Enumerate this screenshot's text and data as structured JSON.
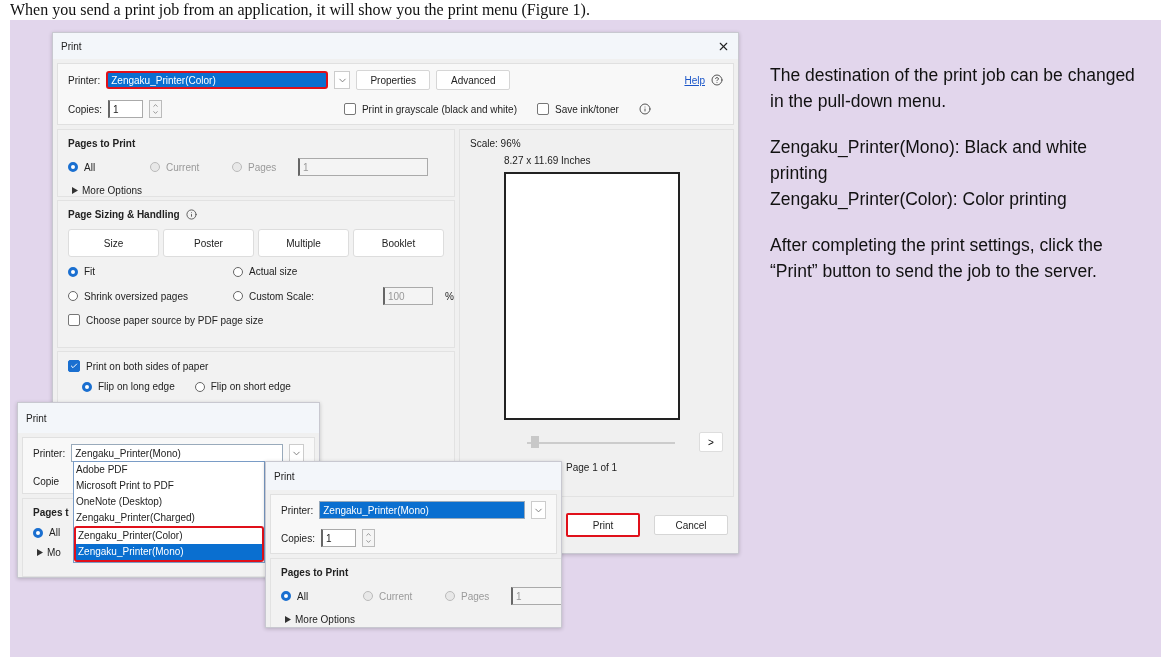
{
  "caption": "When you send a print job from an application, it will show you the print menu (Figure 1).",
  "main_dialog": {
    "title": "Print",
    "printer": {
      "label": "Printer:",
      "value": "Zengaku_Printer(Color)",
      "highlighted": true
    },
    "buttons": [
      "Properties",
      "Advanced"
    ],
    "help_link": "Help",
    "copies": {
      "label": "Copies:",
      "value": "1"
    },
    "options": [
      {
        "label": "Print in grayscale (black and white)",
        "checked": false
      },
      {
        "label": "Save ink/toner",
        "checked": false
      }
    ],
    "pages_to_print": {
      "title": "Pages to Print",
      "radios": [
        {
          "label": "All",
          "selected": true,
          "disabled": false
        },
        {
          "label": "Current",
          "selected": false,
          "disabled": true
        },
        {
          "label": "Pages",
          "selected": false,
          "disabled": true
        }
      ],
      "pages_value": "1",
      "more_options": "More Options"
    },
    "sizing": {
      "title": "Page Sizing & Handling",
      "modes": [
        "Size",
        "Poster",
        "Multiple",
        "Booklet"
      ],
      "radios": [
        {
          "label": "Fit",
          "selected": true
        },
        {
          "label": "Actual size",
          "selected": false
        },
        {
          "label": "Shrink oversized pages",
          "selected": false
        },
        {
          "label": "Custom Scale:",
          "selected": false
        }
      ],
      "scale_value": "100",
      "percent": "%",
      "paper_source": {
        "label": "Choose paper source by PDF page size",
        "checked": false
      }
    },
    "duplex": {
      "label": "Print on both sides of paper",
      "checked": true,
      "radios": [
        {
          "label": "Flip on long edge",
          "selected": true
        },
        {
          "label": "Flip on short edge",
          "selected": false
        }
      ]
    },
    "preview": {
      "scale": "Scale: 96%",
      "size": "8.27 x 11.69 Inches",
      "slider": {
        "level": 0
      },
      "next": ">",
      "page": "Page 1 of 1"
    },
    "actions": [
      {
        "label": "Print",
        "highlighted": true
      },
      {
        "label": "Cancel",
        "highlighted": false
      }
    ]
  },
  "dropdown_dialog": {
    "title": "Print",
    "printer": {
      "label": "Printer:",
      "value": "Zengaku_Printer(Mono)"
    },
    "copies_label": "Copie",
    "pages_title": "Pages t",
    "radio": {
      "label": "All",
      "selected": true
    },
    "more_options": "Mo",
    "list": [
      {
        "label": "Adobe PDF",
        "selected": false,
        "highlighted": false
      },
      {
        "label": "Microsoft Print to PDF",
        "selected": false,
        "highlighted": false
      },
      {
        "label": "OneNote (Desktop)",
        "selected": false,
        "highlighted": false
      },
      {
        "label": "Zengaku_Printer(Charged)",
        "selected": false,
        "highlighted": false
      },
      {
        "label": "Zengaku_Printer(Color)",
        "selected": false,
        "highlighted": true
      },
      {
        "label": "Zengaku_Printer(Mono)",
        "selected": true,
        "highlighted": true
      }
    ]
  },
  "mono_dialog": {
    "title": "Print",
    "printer": {
      "label": "Printer:",
      "value": "Zengaku_Printer(Mono)",
      "highlighted": true
    },
    "copies": {
      "label": "Copies:",
      "value": "1"
    },
    "pages_to_print": {
      "title": "Pages to Print",
      "radios": [
        {
          "label": "All",
          "selected": true,
          "disabled": false
        },
        {
          "label": "Current",
          "selected": false,
          "disabled": true
        },
        {
          "label": "Pages",
          "selected": false,
          "disabled": true
        }
      ],
      "pages_value": "1",
      "more_options": "More Options"
    }
  },
  "notes": [
    [
      "The destination of the print job can be changed in the pull-down menu."
    ],
    [
      "Zengaku_Printer(Mono): Black and white printing",
      "Zengaku_Printer(Color): Color printing"
    ],
    [
      "After completing the print settings, click the “Print” button to send the job to the server."
    ]
  ]
}
